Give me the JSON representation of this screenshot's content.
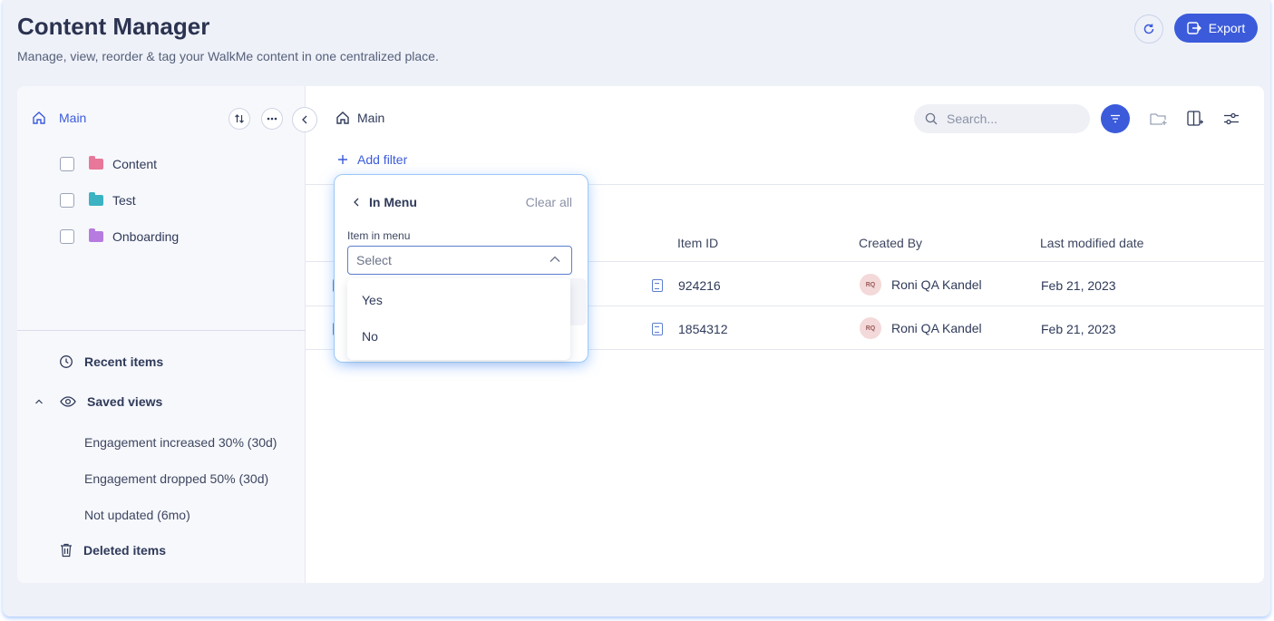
{
  "header": {
    "title": "Content Manager",
    "subtitle": "Manage, view, reorder & tag your WalkMe content in one centralized place.",
    "export_label": "Export"
  },
  "sidebar": {
    "root_label": "Main",
    "folders": [
      {
        "label": "Content",
        "color": "#e8779a"
      },
      {
        "label": "Test",
        "color": "#3bb3c3"
      },
      {
        "label": "Onboarding",
        "color": "#b77be0"
      }
    ],
    "recent_label": "Recent items",
    "saved_views_label": "Saved views",
    "saved_views": [
      "Engagement increased 30% (30d)",
      "Engagement dropped 50% (30d)",
      "Not updated (6mo)"
    ],
    "deleted_label": "Deleted items"
  },
  "content": {
    "breadcrumb": "Main",
    "search_placeholder": "Search...",
    "add_filter_label": "Add filter",
    "columns": {
      "item_id": "Item ID",
      "created_by": "Created By",
      "last_modified": "Last modified date"
    },
    "rows": [
      {
        "item_id": "924216",
        "initials": "RQ",
        "created_by": "Roni QA Kandel",
        "modified": "Feb 21, 2023"
      },
      {
        "item_id": "1854312",
        "initials": "RQ",
        "created_by": "Roni QA Kandel",
        "modified": "Feb 21, 2023"
      }
    ]
  },
  "filter_popover": {
    "title": "In Menu",
    "clear_label": "Clear all",
    "field_label": "Item in menu",
    "select_placeholder": "Select",
    "options": [
      "Yes",
      "No"
    ]
  },
  "colors": {
    "accent": "#3b5bdb",
    "background": "#eef1f8"
  }
}
